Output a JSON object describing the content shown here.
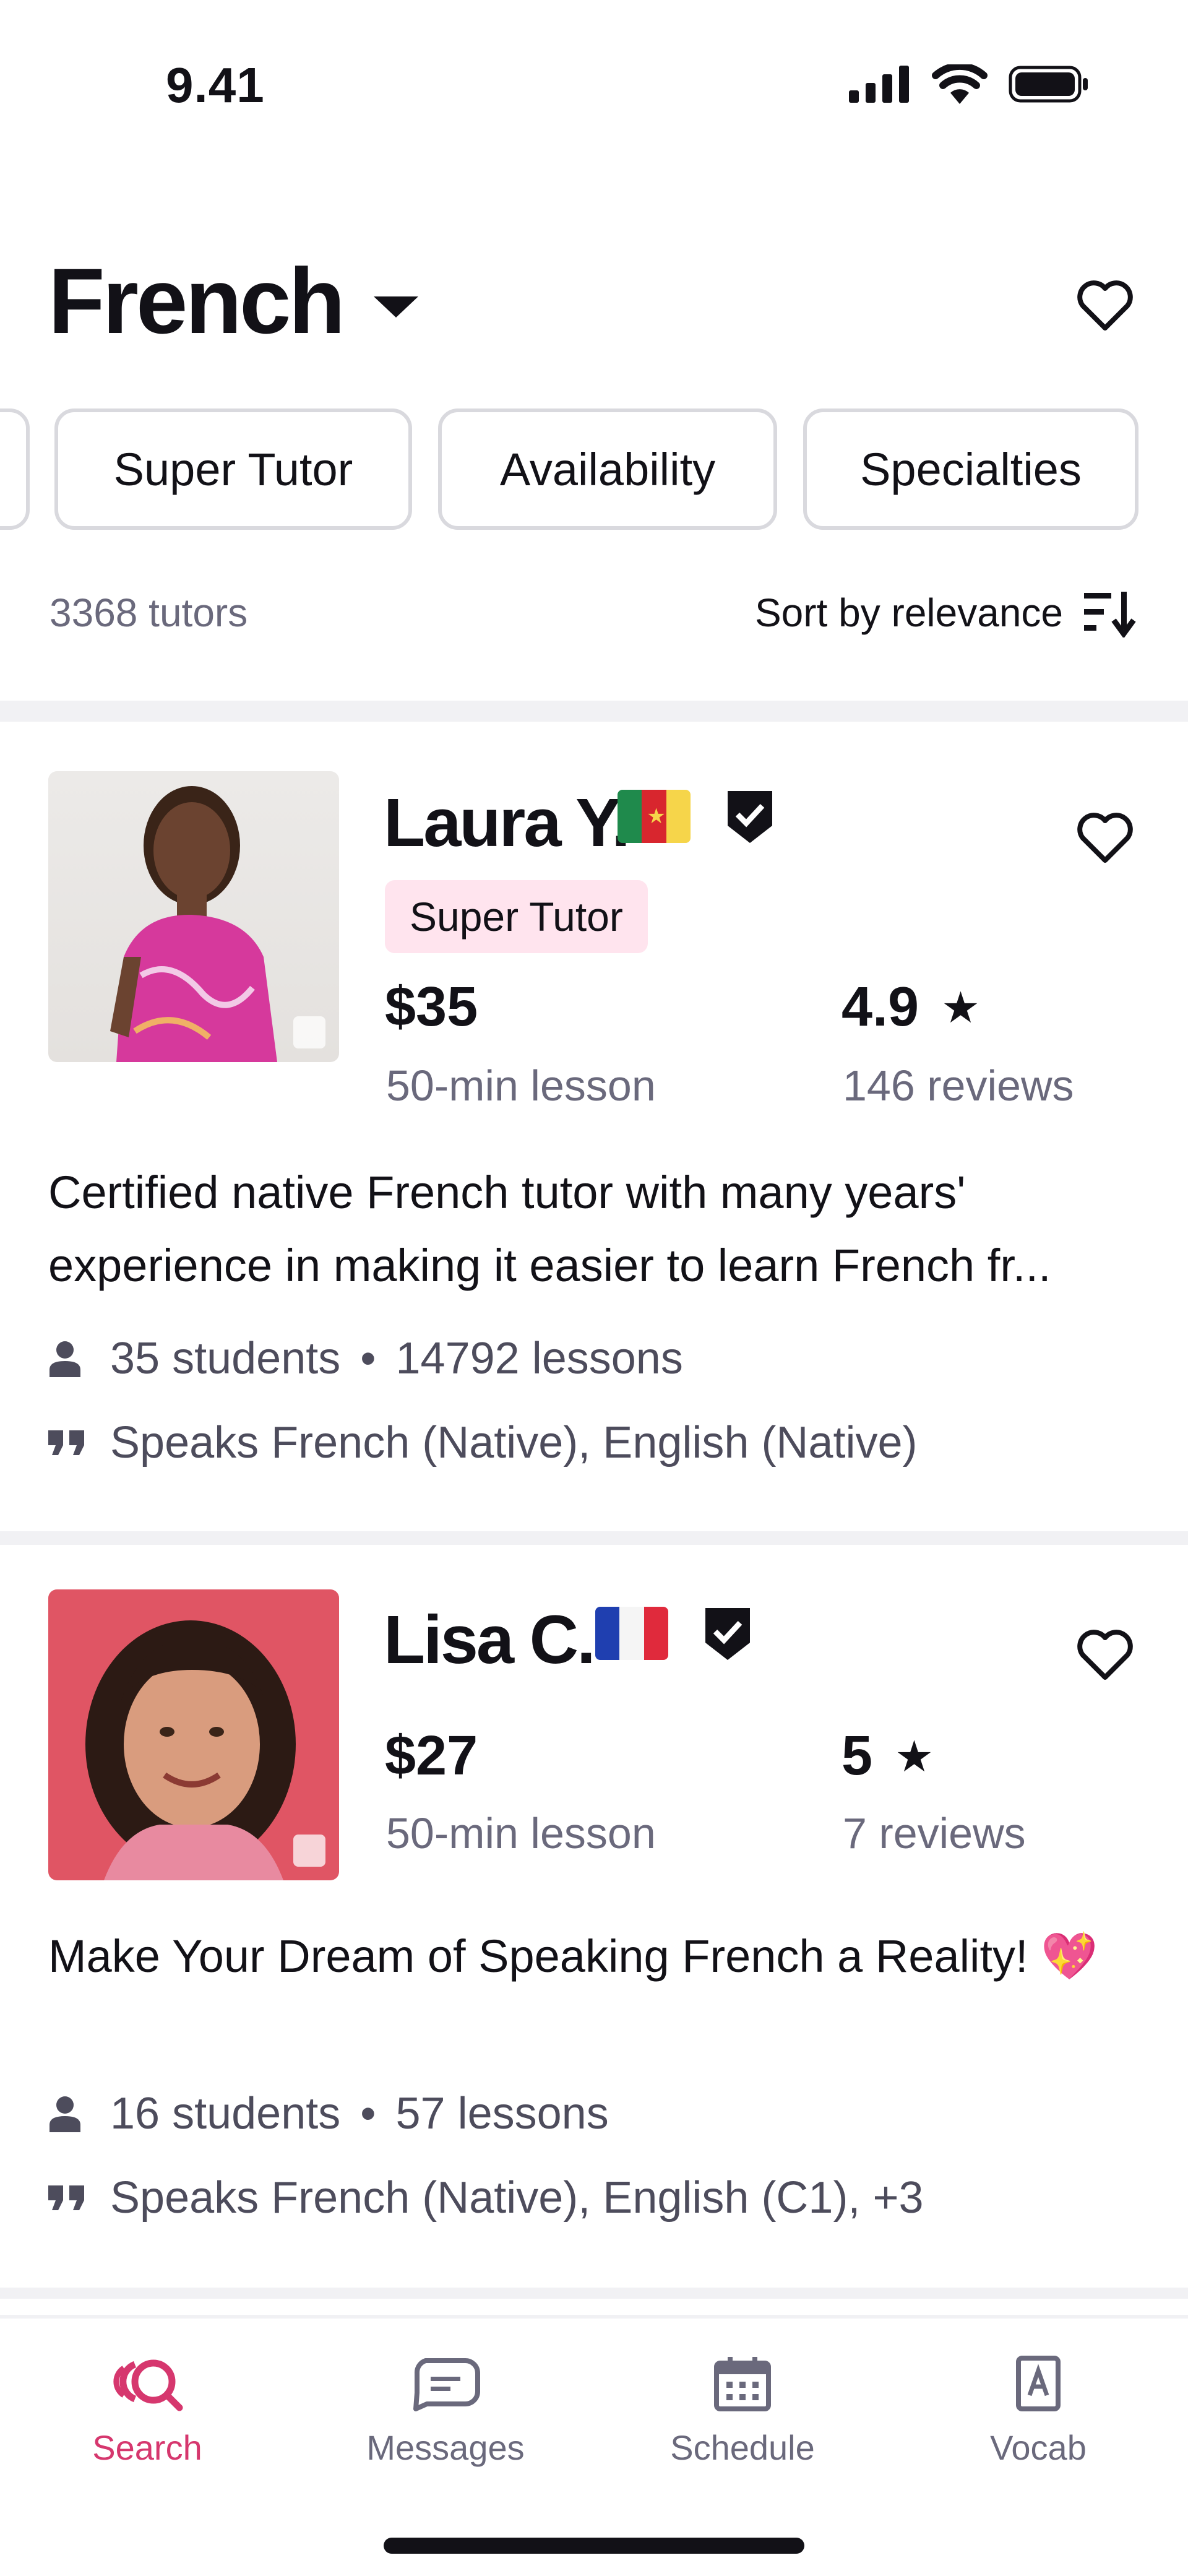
{
  "status_bar": {
    "time": "9.41"
  },
  "header": {
    "title": "French"
  },
  "filters": [
    "Super Tutor",
    "Availability",
    "Specialties"
  ],
  "results": {
    "count_text": "3368 tutors",
    "sort_label": "Sort by relevance"
  },
  "tutors": [
    {
      "name": "Laura Y.",
      "badge": "Super Tutor",
      "price": "$35",
      "lesson": "50-min lesson",
      "rating": "4.9",
      "reviews": "146 reviews",
      "description": "Certified native French tutor with many years' experience in making it easier to learn French fr...",
      "students": "35 students",
      "lessons": "14792 lessons",
      "speaks": "Speaks French (Native), English (Native)",
      "flag": "cameroon-flag"
    },
    {
      "name": "Lisa C.",
      "price": "$27",
      "lesson": "50-min lesson",
      "rating": "5",
      "reviews": "7 reviews",
      "description": "Make Your Dream of Speaking French a Reality! 💖",
      "students": "16 students",
      "lessons": "57 lessons",
      "speaks": "Speaks French (Native), English (C1), +3",
      "flag": "france-flag"
    }
  ],
  "nav": [
    {
      "label": "Search",
      "icon": "search-icon",
      "active": true
    },
    {
      "label": "Messages",
      "icon": "messages-icon"
    },
    {
      "label": "Schedule",
      "icon": "calendar-icon"
    },
    {
      "label": "Vocab",
      "icon": "vocab-icon"
    }
  ],
  "colors": {
    "accent": "#d6376e",
    "super_tutor_bg": "#ffe4ee",
    "divider": "#f1f1f4",
    "muted": "#6a697c"
  }
}
